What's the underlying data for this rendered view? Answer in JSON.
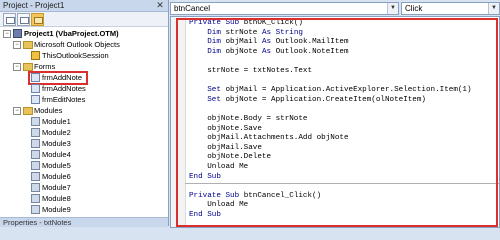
{
  "project_explorer": {
    "title": "Project - Project1",
    "close_glyph": "✕",
    "tree": {
      "root": "Project1 (VbaProject.OTM)",
      "outlook_folder": "Microsoft Outlook Objects",
      "session": "ThisOutlookSession",
      "forms_folder": "Forms",
      "forms": [
        "frmAddNote",
        "frmAddNotes",
        "frmEditNotes"
      ],
      "modules_folder": "Modules",
      "modules": [
        "Module1",
        "Module2",
        "Module3",
        "Module4",
        "Module5",
        "Module6",
        "Module7",
        "Module8",
        "Module9"
      ]
    }
  },
  "properties_bar": {
    "title": "Properties - txtNotes"
  },
  "code_window": {
    "object_combo": "btnCancel",
    "procedure_combo": "Click",
    "lines": [
      [
        {
          "k": "kw",
          "t": "Private Sub "
        },
        {
          "k": "tx",
          "t": "btnOK_Click()"
        }
      ],
      [
        {
          "k": "kw",
          "t": "    Dim "
        },
        {
          "k": "tx",
          "t": "strNote "
        },
        {
          "k": "kw",
          "t": "As String"
        }
      ],
      [
        {
          "k": "kw",
          "t": "    Dim "
        },
        {
          "k": "tx",
          "t": "objMail "
        },
        {
          "k": "kw",
          "t": "As "
        },
        {
          "k": "tx",
          "t": "Outlook.MailItem"
        }
      ],
      [
        {
          "k": "kw",
          "t": "    Dim "
        },
        {
          "k": "tx",
          "t": "objNote "
        },
        {
          "k": "kw",
          "t": "As "
        },
        {
          "k": "tx",
          "t": "Outlook.NoteItem"
        }
      ],
      [
        {
          "k": "tx",
          "t": ""
        }
      ],
      [
        {
          "k": "tx",
          "t": "    strNote = txtNotes.Text"
        }
      ],
      [
        {
          "k": "tx",
          "t": ""
        }
      ],
      [
        {
          "k": "kw",
          "t": "    Set "
        },
        {
          "k": "tx",
          "t": "objMail = Application.ActiveExplorer.Selection.Item(1)"
        }
      ],
      [
        {
          "k": "kw",
          "t": "    Set "
        },
        {
          "k": "tx",
          "t": "objNote = Application.CreateItem(olNoteItem)"
        }
      ],
      [
        {
          "k": "tx",
          "t": ""
        }
      ],
      [
        {
          "k": "tx",
          "t": "    objNote.Body = strNote"
        }
      ],
      [
        {
          "k": "tx",
          "t": "    objNote.Save"
        }
      ],
      [
        {
          "k": "tx",
          "t": "    objMail.Attachments.Add objNote"
        }
      ],
      [
        {
          "k": "tx",
          "t": "    objMail.Save"
        }
      ],
      [
        {
          "k": "tx",
          "t": "    objNote.Delete"
        }
      ],
      [
        {
          "k": "tx",
          "t": "    Unload Me"
        }
      ],
      [
        {
          "k": "kw",
          "t": "End Sub"
        }
      ],
      [
        {
          "k": "tx",
          "t": ""
        }
      ],
      [
        {
          "k": "kw",
          "t": "Private Sub "
        },
        {
          "k": "tx",
          "t": "btnCancel_Click()"
        }
      ],
      [
        {
          "k": "tx",
          "t": "    Unload Me"
        }
      ],
      [
        {
          "k": "kw",
          "t": "End Sub"
        }
      ]
    ]
  },
  "colors": {
    "keyword": "#00008b",
    "highlight_box": "#d9302f"
  }
}
